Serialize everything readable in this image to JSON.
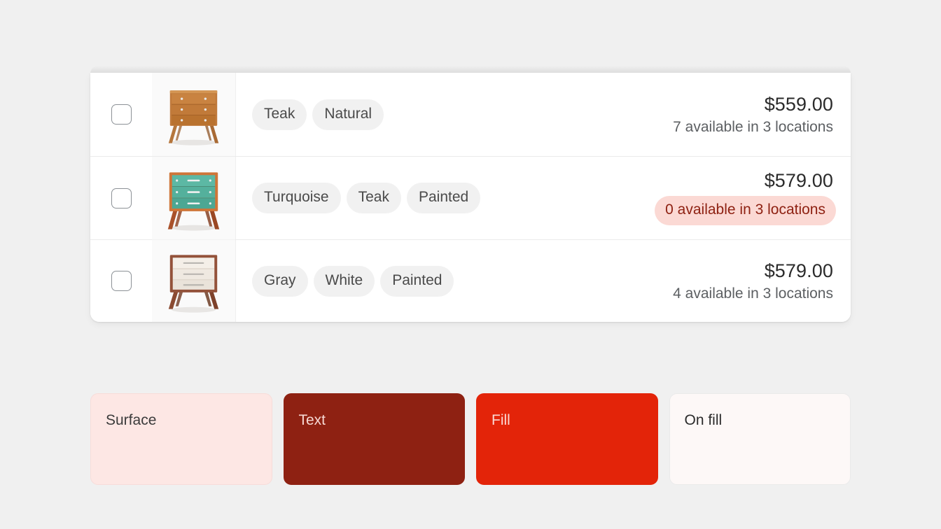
{
  "page": {
    "background_color": "#f0f0f0"
  },
  "product_card": {
    "columns": [
      "select",
      "image",
      "options",
      "price_and_availability"
    ],
    "rows": [
      {
        "checkbox": {
          "checked": false,
          "label": ""
        },
        "image": {
          "name": "teak-natural-dresser-thumbnail",
          "alt": "Teak wood three drawer dresser"
        },
        "tags": [
          "Teak",
          "Natural"
        ],
        "price": "$559.00",
        "availability": "7 available in 3 locations",
        "availability_critical": false
      },
      {
        "checkbox": {
          "checked": false,
          "label": ""
        },
        "image": {
          "name": "turquoise-teak-dresser-thumbnail",
          "alt": "Turquoise painted three drawer dresser with teak frame"
        },
        "tags": [
          "Turquoise",
          "Teak",
          "Painted"
        ],
        "price": "$579.00",
        "availability": "0 available in 3 locations",
        "availability_critical": true
      },
      {
        "checkbox": {
          "checked": false,
          "label": ""
        },
        "image": {
          "name": "gray-white-dresser-thumbnail",
          "alt": "Gray and white painted three drawer dresser"
        },
        "tags": [
          "Gray",
          "White",
          "Painted"
        ],
        "price": "$579.00",
        "availability": "4 available in 3 locations",
        "availability_critical": false
      }
    ]
  },
  "color_swatches": [
    {
      "label": "Surface",
      "background": "#fde7e4",
      "text_color": "#3b3b3b",
      "border": "#f7dcd9"
    },
    {
      "label": "Text",
      "background": "#8e2112",
      "text_color": "#f7d9d4",
      "border": "transparent"
    },
    {
      "label": "Fill",
      "background": "#e32409",
      "text_color": "#fbd9d4",
      "border": "transparent"
    },
    {
      "label": "On fill",
      "background": "#fdf8f7",
      "text_color": "#2b2b2b",
      "border": "#eaeaea"
    }
  ],
  "tokens": {
    "tag_background": "#f1f1f1",
    "tag_text": "#4a4a4a",
    "critical_surface": "#fbd9d4",
    "critical_text": "#8e2112",
    "divider": "#ebebeb",
    "card_surface": "#ffffff",
    "thumb_surface": "#fafafa"
  }
}
